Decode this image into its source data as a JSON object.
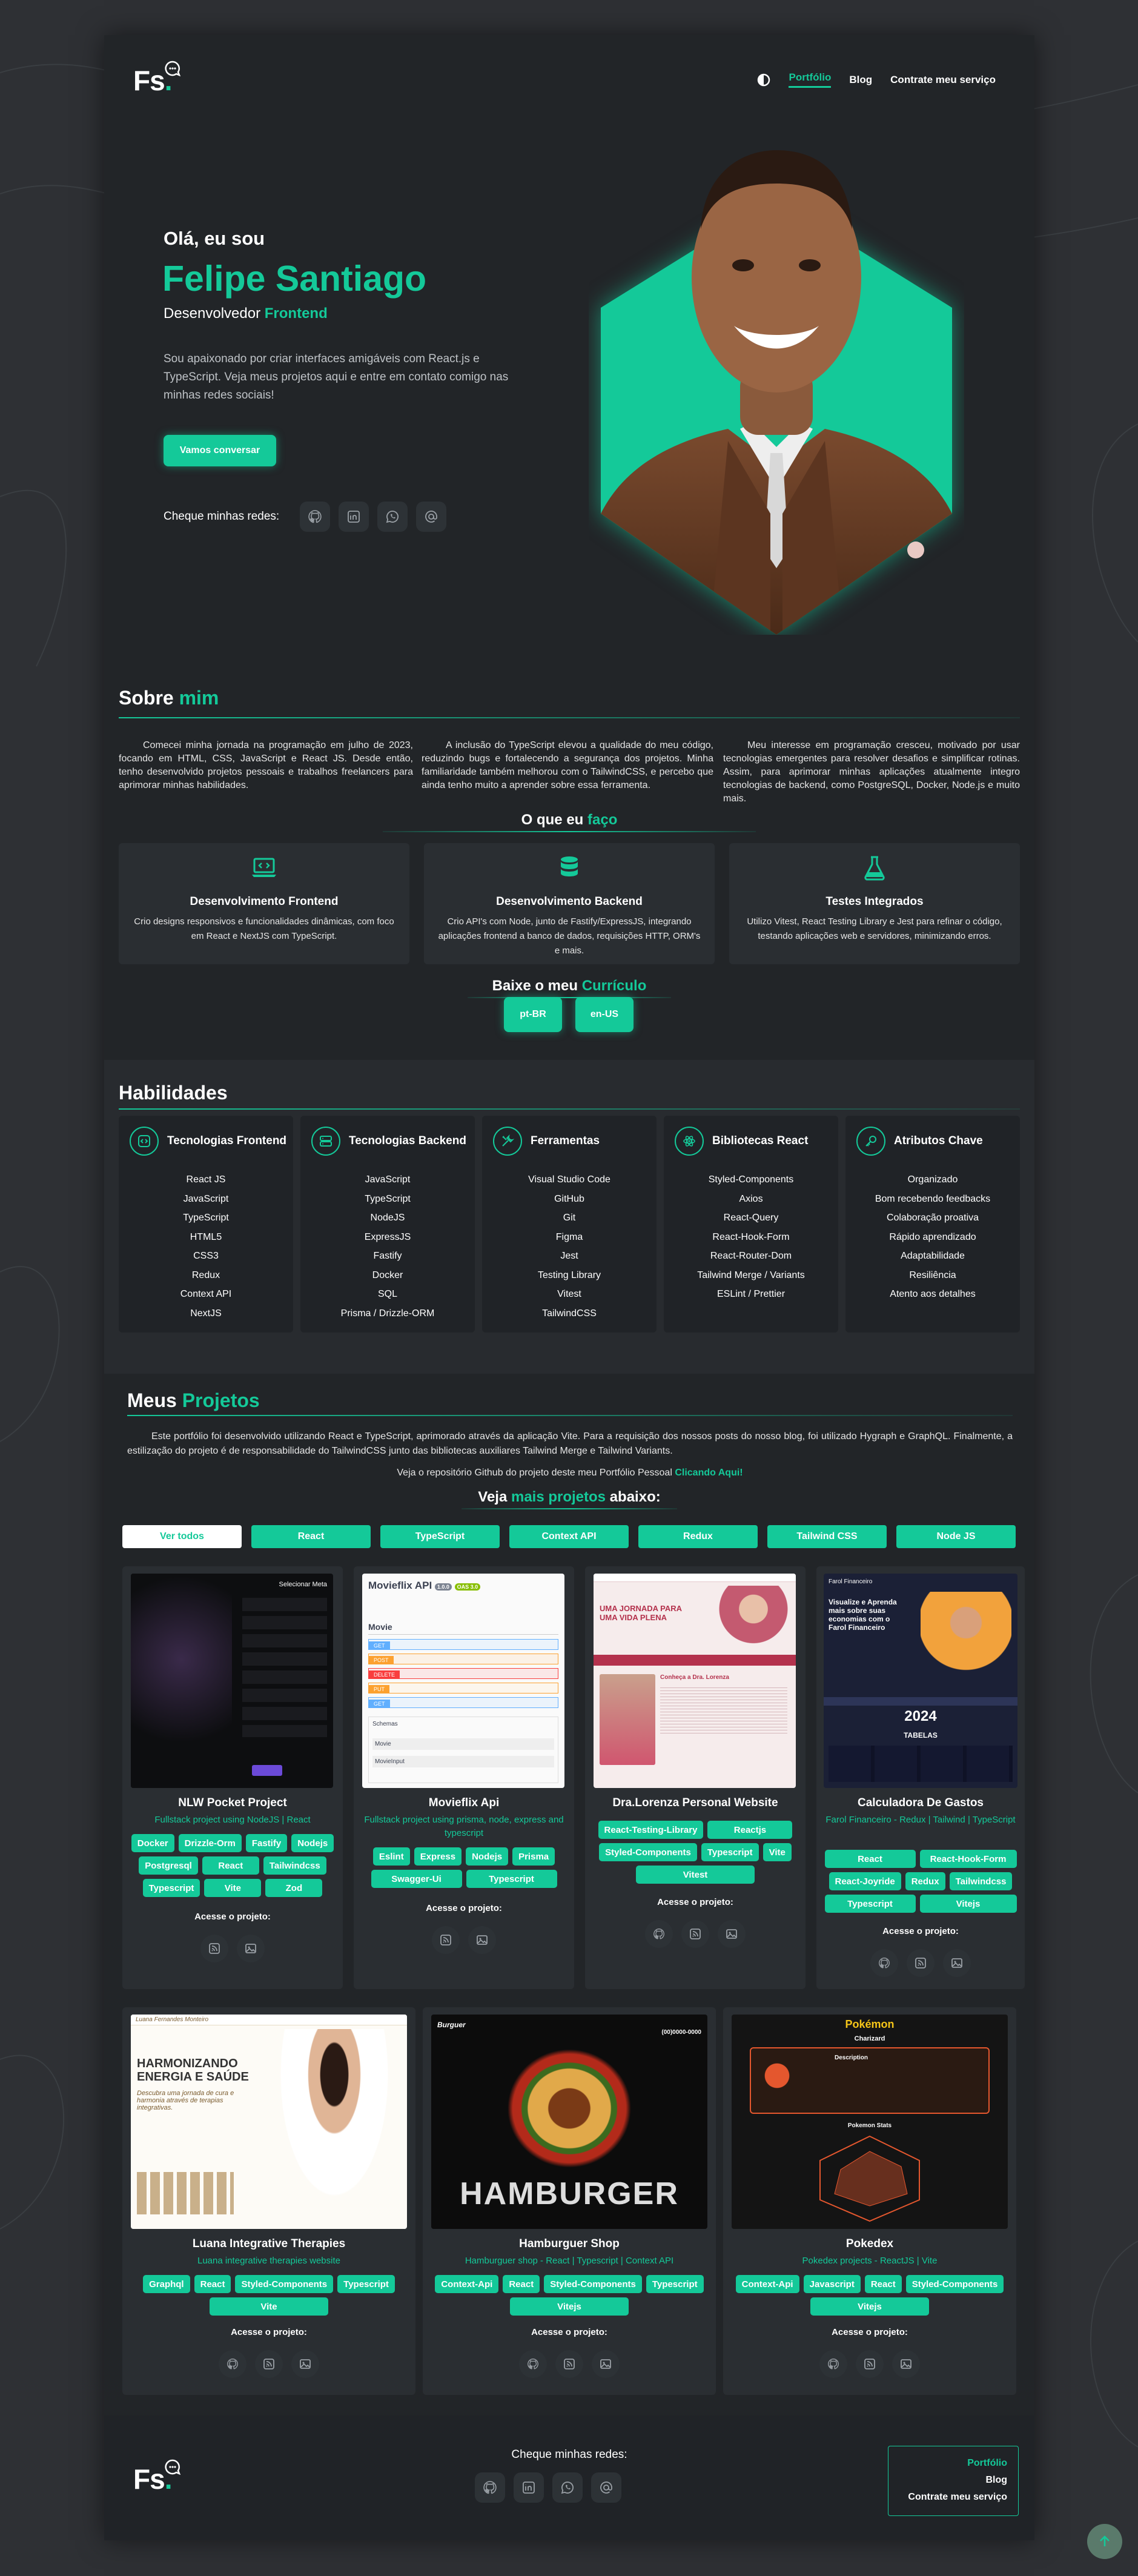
{
  "header": {
    "logo": "Fs",
    "nav": [
      {
        "label": "Portfólio",
        "active": true
      },
      {
        "label": "Blog"
      },
      {
        "label": "Contrate meu serviço"
      }
    ],
    "theme_toggle_icon": "half-circle-icon"
  },
  "hero": {
    "greeting": "Olá, eu sou",
    "name": "Felipe Santiago",
    "role_prefix": "Desenvolvedor",
    "role_highlight": "Frontend",
    "intro": "Sou apaixonado por criar interfaces amigáveis com React.js e TypeScript. Veja meus projetos aqui e entre em contato comigo nas minhas redes sociais!",
    "cta": "Vamos conversar",
    "socials_label": "Cheque minhas redes:",
    "socials": [
      "github-icon",
      "linkedin-icon",
      "whatsapp-icon",
      "email-at-icon"
    ]
  },
  "about": {
    "title": "Sobre",
    "title_highlight": "mim",
    "col1": "Comecei minha jornada na programação em julho de 2023, focando em HTML, CSS, JavaScript e React JS. Desde então, tenho desenvolvido projetos pessoais e trabalhos freelancers para aprimorar minhas habilidades.",
    "col2": "A inclusão do TypeScript elevou a qualidade do meu código, reduzindo bugs e fortalecendo a segurança dos projetos. Minha familiaridade também melhorou com o TailwindCSS, e percebo que ainda tenho muito a aprender sobre essa ferramenta.",
    "col3": "Meu interesse em programação cresceu, motivado por usar tecnologias emergentes para resolver desafios e simplificar rotinas. Assim, para aprimorar minhas aplicações atualmente integro tecnologias de backend, como PostgreSQL, Docker, Node.js e muito mais.",
    "services_title": "O que eu",
    "services_title_highlight": "faço",
    "services": [
      {
        "icon": "laptop-code-icon",
        "title": "Desenvolvimento Frontend",
        "desc": "Crio designs responsivos e funcionalidades dinâmicas, com foco em React e NextJS com TypeScript."
      },
      {
        "icon": "database-icon",
        "title": "Desenvolvimento Backend",
        "desc": "Crio API's com Node, junto de Fastify/ExpressJS, integrando aplicações frontend a banco de dados, requisições HTTP, ORM's e mais."
      },
      {
        "icon": "flask-icon",
        "title": "Testes Integrados",
        "desc": "Utilizo Vitest, React Testing Library e Jest para refinar o código, testando aplicações web e servidores, minimizando erros."
      }
    ],
    "cv_title": "Baixe o meu",
    "cv_title_highlight": "Currículo",
    "cv_buttons": [
      "pt-BR",
      "en-US"
    ]
  },
  "skills": {
    "title": "Habilidades",
    "groups": [
      {
        "icon": "code-icon",
        "title": "Tecnologias Frontend",
        "items": [
          "React JS",
          "JavaScript",
          "TypeScript",
          "HTML5",
          "CSS3",
          "Redux",
          "Context API",
          "NextJS"
        ]
      },
      {
        "icon": "server-icon",
        "title": "Tecnologias Backend",
        "items": [
          "JavaScript",
          "TypeScript",
          "NodeJS",
          "ExpressJS",
          "Fastify",
          "Docker",
          "SQL",
          "Prisma / Drizzle-ORM"
        ]
      },
      {
        "icon": "tools-icon",
        "title": "Ferramentas",
        "items": [
          "Visual Studio Code",
          "GitHub",
          "Git",
          "Figma",
          "Jest",
          "Testing Library",
          "Vitest",
          "TailwindCSS"
        ]
      },
      {
        "icon": "react-atom-icon",
        "title": "Bibliotecas React",
        "items": [
          "Styled-Components",
          "Axios",
          "React-Query",
          "React-Hook-Form",
          "React-Router-Dom",
          "Tailwind Merge / Variants",
          "ESLint / Prettier"
        ]
      },
      {
        "icon": "key-icon",
        "title": "Atributos Chave",
        "items": [
          "Organizado",
          "Bom recebendo feedbacks",
          "Colaboração proativa",
          "Rápido aprendizado",
          "Adaptabilidade",
          "Resiliência",
          "Atento aos detalhes"
        ]
      }
    ]
  },
  "projects": {
    "title": "Meus",
    "title_highlight": "Projetos",
    "desc": "Este portfólio foi desenvolvido utilizando React e TypeScript, aprimorado através da aplicação Vite. Para a requisição dos nossos posts do nosso blog, foi utilizado Hygraph e GraphQL. Finalmente, a estilização do projeto é de responsabilidade do TailwindCSS junto das bibliotecas auxiliares Tailwind Merge e Tailwind Variants.",
    "repo_text": "Veja o repositório Github do projeto deste meu Portfólio Pessoal",
    "repo_link": "Clicando Aqui!",
    "filter_title_pre": "Veja",
    "filter_title_highlight": "mais projetos",
    "filter_title_post": "abaixo:",
    "filters": [
      {
        "label": "Ver todos",
        "active": true
      },
      {
        "label": "React"
      },
      {
        "label": "TypeScript"
      },
      {
        "label": "Context API"
      },
      {
        "label": "Redux"
      },
      {
        "label": "Tailwind CSS"
      },
      {
        "label": "Node JS"
      }
    ],
    "access_label": "Acesse o projeto:",
    "items": [
      {
        "title": "NLW Pocket Project",
        "subtitle": "Fullstack project using NodeJS | React",
        "tags": [
          "Docker",
          "Drizzle-Orm",
          "Fastify",
          "Nodejs",
          "Postgresql",
          "React",
          "Tailwindcss",
          "Typescript",
          "Vite",
          "Zod"
        ],
        "links": [
          "deploy-icon",
          "image-icon"
        ]
      },
      {
        "title": "Movieflix Api",
        "subtitle": "Fullstack project using prisma, node, express and typescript",
        "tags": [
          "Eslint",
          "Express",
          "Nodejs",
          "Prisma",
          "Swagger-Ui",
          "Typescript"
        ],
        "links": [
          "deploy-icon",
          "image-icon"
        ]
      },
      {
        "title": "Dra.Lorenza Personal Website",
        "subtitle": "",
        "tags": [
          "React-Testing-Library",
          "Reactjs",
          "Styled-Components",
          "Typescript",
          "Vite",
          "Vitest"
        ],
        "links": [
          "github-icon",
          "deploy-icon",
          "image-icon"
        ]
      },
      {
        "title": "Calculadora De Gastos",
        "subtitle": "Farol Financeiro - Redux | Tailwind | TypeScript",
        "tags": [
          "React",
          "React-Hook-Form",
          "React-Joyride",
          "Redux",
          "Tailwindcss",
          "Typescript",
          "Vitejs"
        ],
        "links": [
          "github-icon",
          "deploy-icon",
          "image-icon"
        ]
      },
      {
        "title": "Luana Integrative Therapies",
        "subtitle": "Luana integrative therapies website",
        "tags": [
          "Graphql",
          "React",
          "Styled-Components",
          "Typescript",
          "Vite"
        ],
        "links": [
          "github-icon",
          "deploy-icon",
          "image-icon"
        ]
      },
      {
        "title": "Hamburguer Shop",
        "subtitle": "Hamburguer shop - React | Typescript | Context API",
        "tags": [
          "Context-Api",
          "React",
          "Styled-Components",
          "Typescript",
          "Vitejs"
        ],
        "links": [
          "github-icon",
          "deploy-icon",
          "image-icon"
        ]
      },
      {
        "title": "Pokedex",
        "subtitle": "Pokedex projects - ReactJS | Vite",
        "tags": [
          "Context-Api",
          "Javascript",
          "React",
          "Styled-Components",
          "Vitejs"
        ],
        "links": [
          "github-icon",
          "deploy-icon",
          "image-icon"
        ]
      }
    ],
    "shots": [
      {
        "caption": "Selecionar Meta"
      },
      {
        "caption": "Movieflix API",
        "badge1": "1.0.0",
        "badge2": "OAS 3.0",
        "section": "Movie",
        "methods": [
          "GET",
          "POST",
          "DELETE",
          "PUT",
          "GET"
        ],
        "schemas": "Schemas",
        "schema_items": [
          "Movie",
          "MovieInput"
        ]
      },
      {
        "heading": "UMA JORNADA PARA UMA VIDA PLENA",
        "sub": "Conheça a Dra. Lorenza"
      },
      {
        "brand": "Farol Financeiro",
        "headline": "Visualize e Aprenda mais sobre suas economias com o Farol Financeiro",
        "year": "2024",
        "label": "TABELAS"
      },
      {
        "name": "Luana Fernandes Monteiro",
        "headline": "HARMONIZANDO ENERGIA E SAÚDE",
        "sub": "Descubra uma jornada de cura e harmonia através de terapias integrativas."
      },
      {
        "brand": "Burguer",
        "word": "HAMBURGER",
        "phone": "(00)0000-0000"
      },
      {
        "logo": "Pokémon",
        "pokemon": "Charizard",
        "section": "Description",
        "stats_label": "Pokemon Stats"
      }
    ]
  },
  "footer": {
    "logo": "Fs",
    "socials_label": "Cheque minhas redes:",
    "nav": [
      {
        "label": "Portfólio",
        "active": true
      },
      {
        "label": "Blog"
      },
      {
        "label": "Contrate meu serviço"
      }
    ]
  },
  "colors": {
    "accent": "#14c999",
    "page_bg": "#202327",
    "outer_bg": "#2e3034",
    "card_bg": "#2a2e32"
  }
}
